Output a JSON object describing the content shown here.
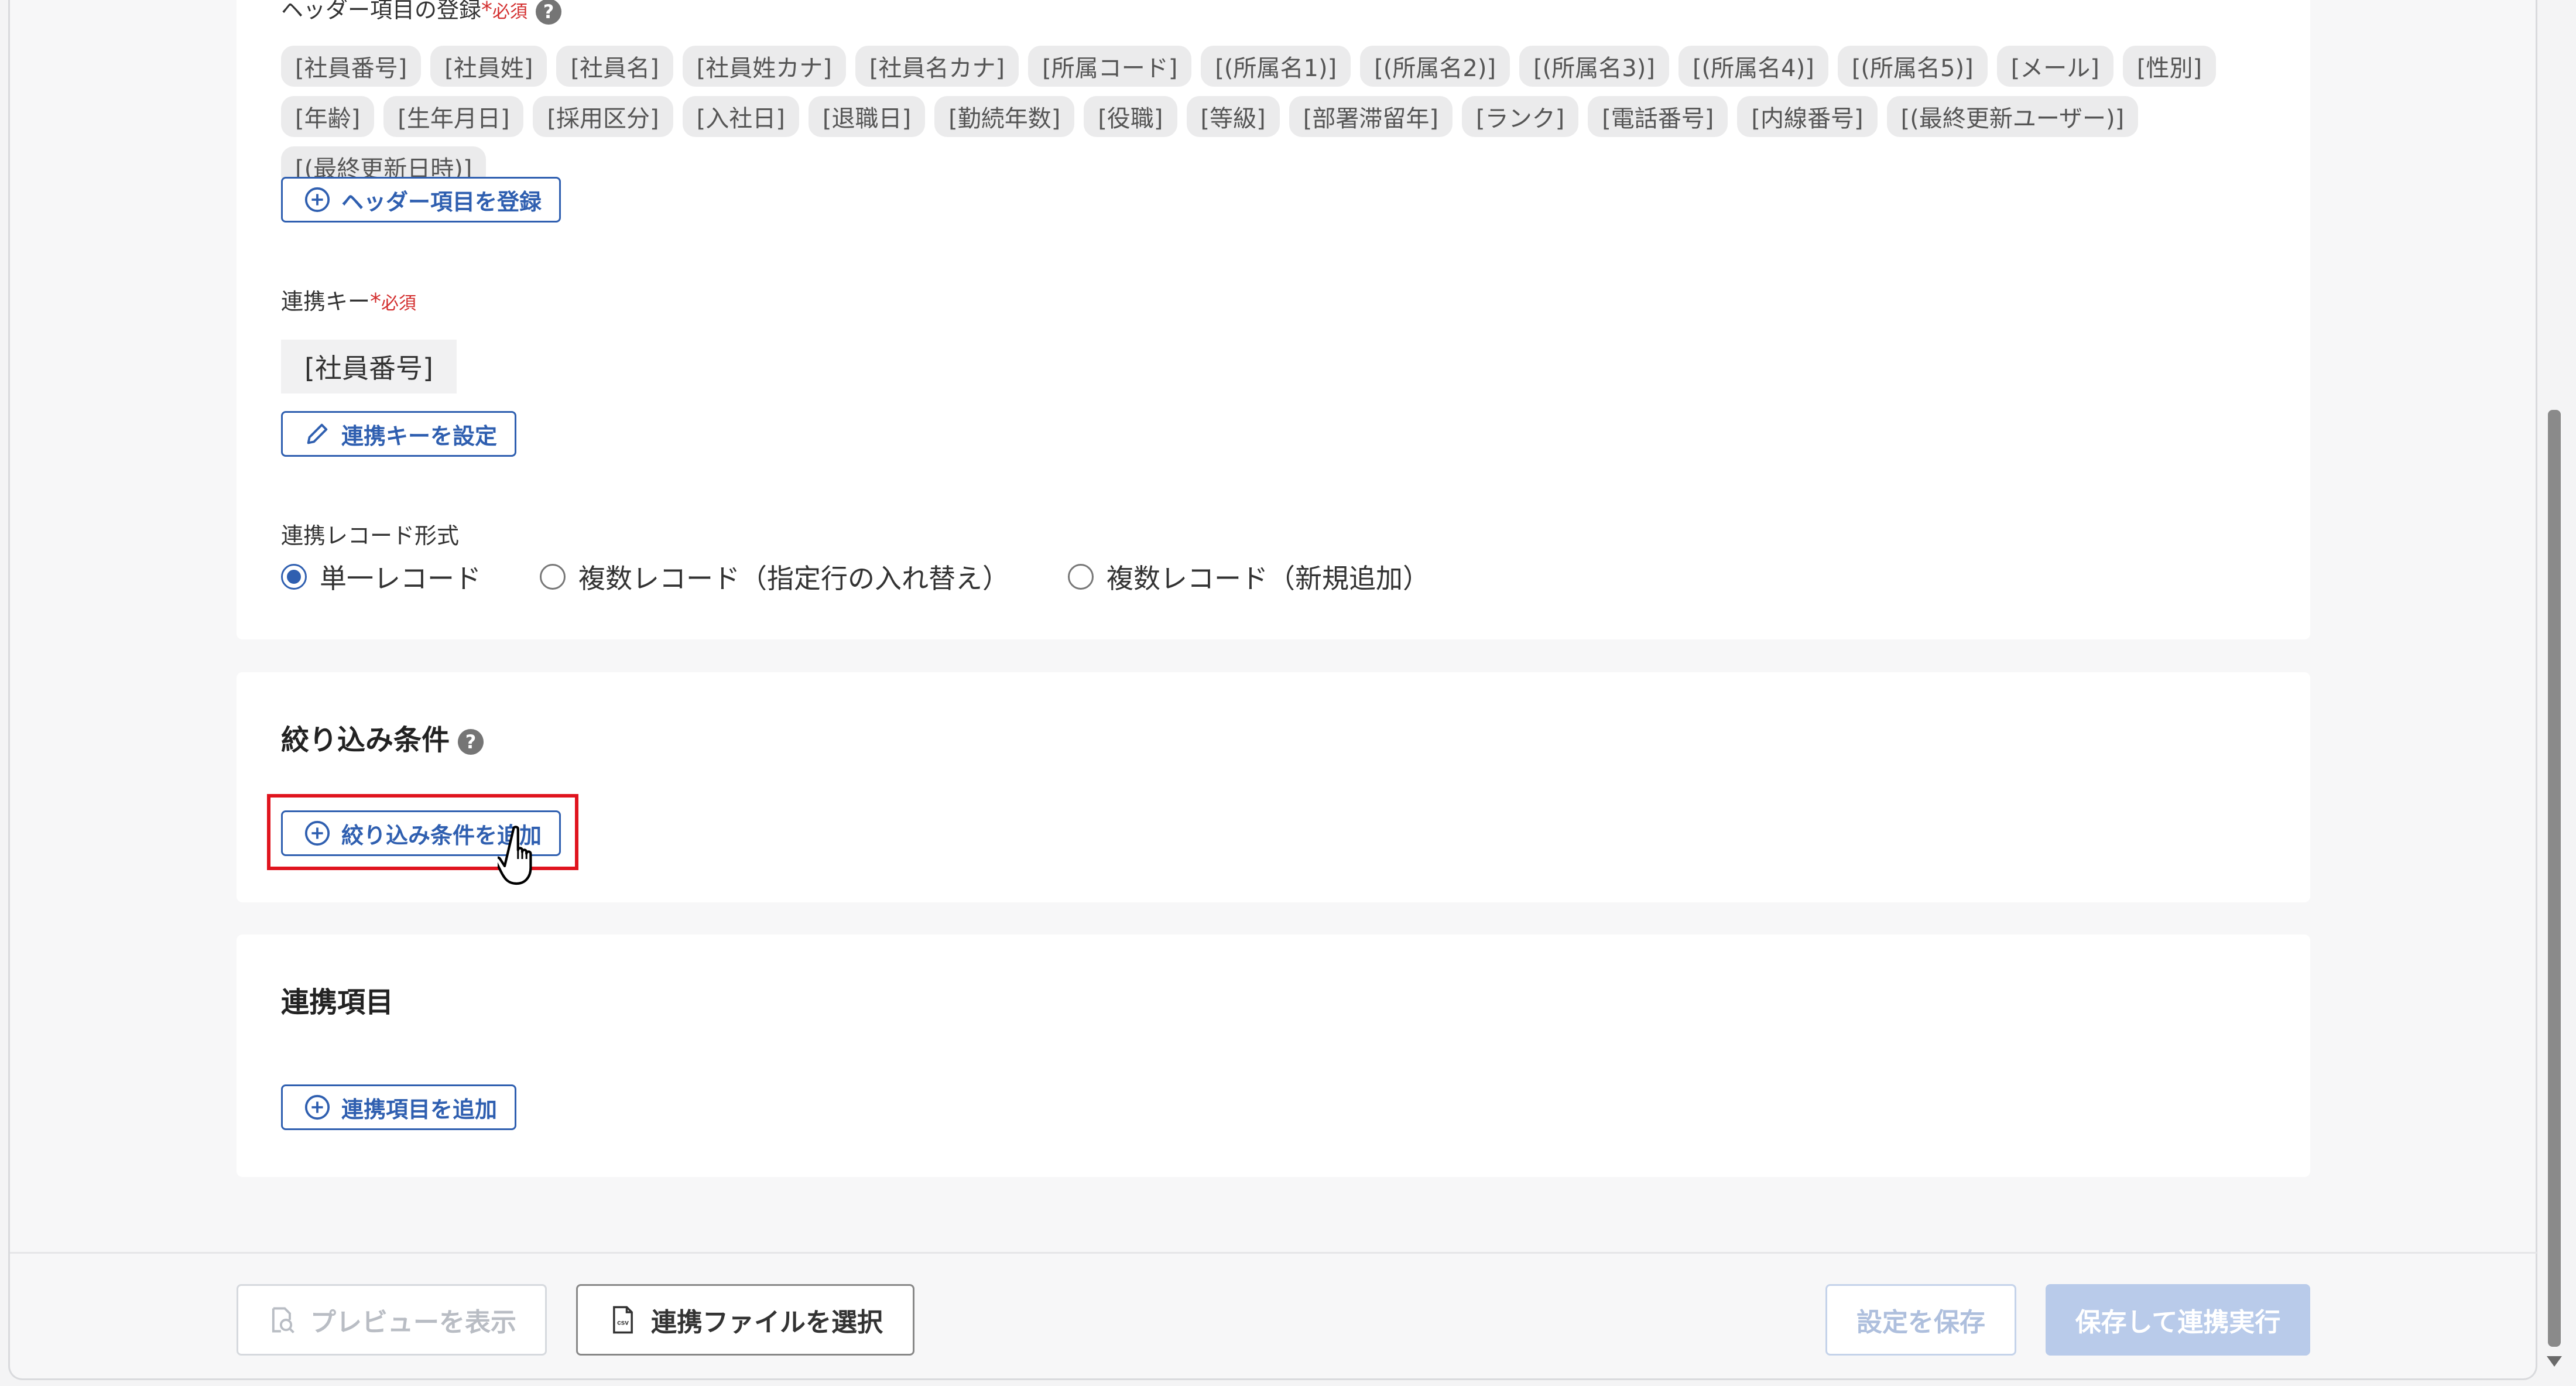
{
  "header_section": {
    "label": "ヘッダー項目の登録",
    "required_mark": "*",
    "required_text": "必須",
    "help_glyph": "?",
    "chips": [
      "[社員番号]",
      "[社員姓]",
      "[社員名]",
      "[社員姓カナ]",
      "[社員名カナ]",
      "[所属コード]",
      "[(所属名1)]",
      "[(所属名2)]",
      "[(所属名3)]",
      "[(所属名4)]",
      "[(所属名5)]",
      "[メール]",
      "[性別]",
      "[年齢]",
      "[生年月日]",
      "[採用区分]",
      "[入社日]",
      "[退職日]",
      "[勤続年数]",
      "[役職]",
      "[等級]",
      "[部署滞留年]",
      "[ランク]",
      "[電話番号]",
      "[内線番号]",
      "[(最終更新ユーザー)]",
      "[(最終更新日時)]"
    ],
    "register_button": "ヘッダー項目を登録"
  },
  "link_key": {
    "label": "連携キー",
    "required_mark": "*",
    "required_text": "必須",
    "value": "[社員番号]",
    "set_button": "連携キーを設定"
  },
  "record_format": {
    "label": "連携レコード形式",
    "options": [
      {
        "label": "単一レコード",
        "checked": true
      },
      {
        "label": "複数レコード（指定行の入れ替え）",
        "checked": false
      },
      {
        "label": "複数レコード（新規追加）",
        "checked": false
      }
    ]
  },
  "filter_section": {
    "title": "絞り込み条件",
    "help_glyph": "?",
    "add_button": "絞り込み条件を追加"
  },
  "link_items_section": {
    "title": "連携項目",
    "add_button": "連携項目を追加"
  },
  "footer": {
    "preview_button": "プレビューを表示",
    "select_file_button": "連携ファイルを選択",
    "save_button": "設定を保存",
    "save_and_run_button": "保存して連携実行"
  },
  "icons": {
    "plus_circle": "plus-circle-icon",
    "pencil": "pencil-icon",
    "preview": "preview-search-icon",
    "csv_file": "csv-file-icon",
    "hand_cursor": "hand-cursor-icon"
  },
  "colors": {
    "accent": "#2f5fb0",
    "required": "#d32f2f",
    "highlight": "#e0141e"
  }
}
